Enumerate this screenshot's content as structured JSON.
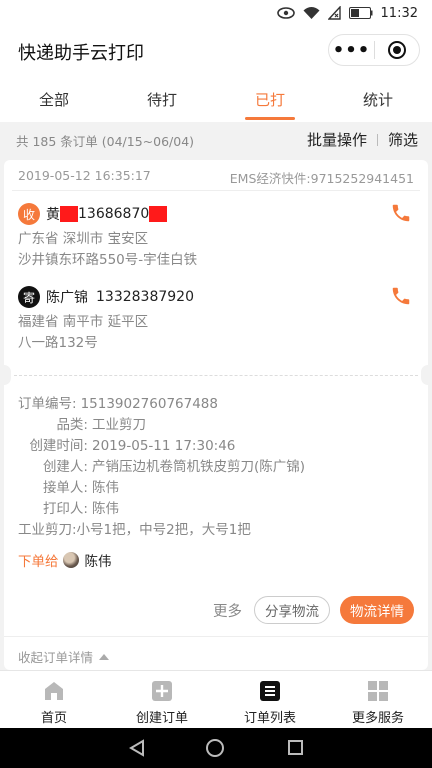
{
  "status_bar": {
    "time": "11:32",
    "icons": [
      "eye-icon",
      "wifi-icon",
      "sim-x-icon",
      "battery-icon"
    ]
  },
  "header": {
    "title": "快递助手云打印",
    "more_label": "•••"
  },
  "tabs": [
    {
      "label": "全部",
      "active": false
    },
    {
      "label": "待打",
      "active": false
    },
    {
      "label": "已打",
      "active": true
    },
    {
      "label": "统计",
      "active": false
    }
  ],
  "subbar": {
    "count_text": "共 185 条订单 (04/15~06/04)",
    "batch_label": "批量操作",
    "filter_label": "筛选"
  },
  "order": {
    "datetime": "2019-05-12 16:35:17",
    "carrier": "EMS经济快件:9715252941451",
    "receiver": {
      "badge": "收",
      "name_visible": "黄",
      "phone_visible": "13686870",
      "region": "广东省 深圳市 宝安区",
      "street": "沙井镇东环路550号-宇佳白铁"
    },
    "sender": {
      "badge": "寄",
      "name": "陈广锦",
      "phone": "13328387920",
      "region": "福建省 南平市 延平区",
      "street": "八一路132号"
    },
    "details": [
      {
        "label": "订单编号:",
        "value": "1513902760767488"
      },
      {
        "label": "品类:",
        "value": "工业剪刀"
      },
      {
        "label": "创建时间:",
        "value": "2019-05-11 17:30:46"
      },
      {
        "label": "创建人:",
        "value": "产销压边机卷筒机铁皮剪刀(陈广锦)"
      },
      {
        "label": "接单人:",
        "value": "陈伟"
      },
      {
        "label": "打印人:",
        "value": "陈伟"
      }
    ],
    "note": "工业剪刀:小号1把，中号2把，大号1把",
    "assign_label": "下单给",
    "assignee": "陈伟",
    "more_label": "更多",
    "share_label": "分享物流",
    "logistics_label": "物流详情",
    "fold_label": "收起订单详情"
  },
  "tabbar": [
    {
      "label": "首页",
      "icon": "home-icon"
    },
    {
      "label": "创建订单",
      "icon": "plus-square-icon"
    },
    {
      "label": "订单列表",
      "icon": "list-icon"
    },
    {
      "label": "更多服务",
      "icon": "grid-icon"
    }
  ],
  "colors": {
    "accent": "#f5793b",
    "muted": "#888888",
    "redaction": "#ff1a1a"
  }
}
